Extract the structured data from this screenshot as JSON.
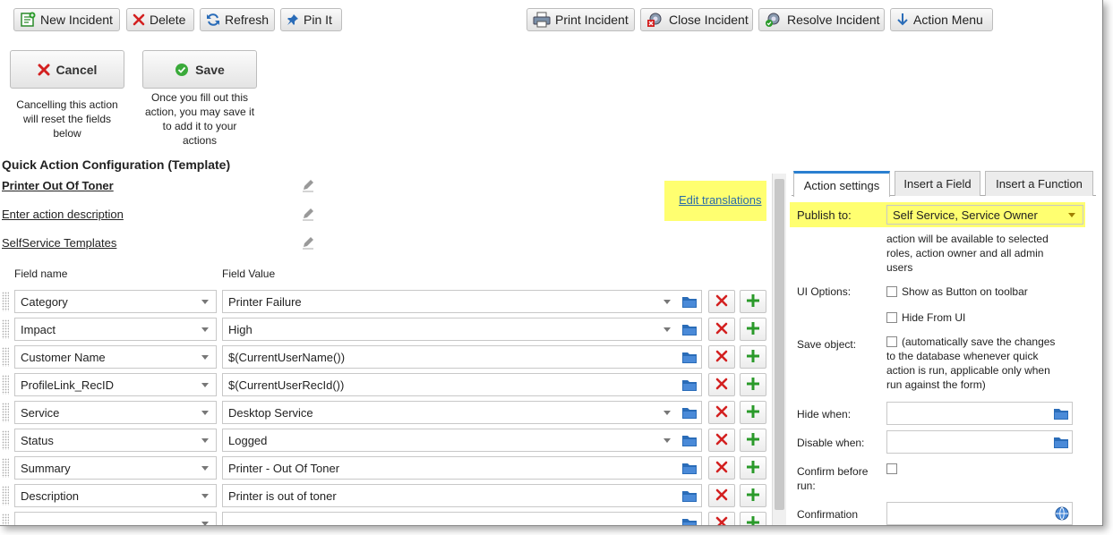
{
  "toolbar": {
    "new_incident": "New Incident",
    "delete": "Delete",
    "refresh": "Refresh",
    "pin_it": "Pin It",
    "print_incident": "Print Incident",
    "close_incident": "Close Incident",
    "resolve_incident": "Resolve Incident",
    "action_menu": "Action Menu"
  },
  "actions": {
    "cancel_label": "Cancel",
    "cancel_help": [
      "Cancelling this action",
      "will reset the fields",
      "below"
    ],
    "save_label": "Save",
    "save_help": [
      "Once you fill out this",
      "action, you may save it",
      "to add it to your",
      "actions"
    ]
  },
  "config": {
    "title": "Quick Action Configuration (Template)",
    "action_name": "Printer Out Of Toner",
    "description": "Enter action description",
    "category": "SelfService Templates",
    "edit_translations": "Edit translations"
  },
  "fields": {
    "col_name": "Field name",
    "col_value": "Field Value",
    "rows": [
      {
        "name": "Category",
        "value": "Printer Failure",
        "dropdown": true
      },
      {
        "name": "Impact",
        "value": "High",
        "dropdown": true
      },
      {
        "name": "Customer Name",
        "value": "$(CurrentUserName())",
        "dropdown": false
      },
      {
        "name": "ProfileLink_RecID",
        "value": "$(CurrentUserRecId())",
        "dropdown": false
      },
      {
        "name": "Service",
        "value": "Desktop Service",
        "dropdown": true
      },
      {
        "name": "Status",
        "value": "Logged",
        "dropdown": true
      },
      {
        "name": "Summary",
        "value": "Printer - Out Of Toner",
        "dropdown": false
      },
      {
        "name": "Description",
        "value": "Printer is out of toner",
        "dropdown": false
      },
      {
        "name": "",
        "value": "",
        "dropdown": false
      }
    ]
  },
  "panel": {
    "tabs": [
      "Action settings",
      "Insert a Field",
      "Insert a Function"
    ],
    "publish_label": "Publish to:",
    "publish_value": "Self Service, Service Owner",
    "publish_help": [
      "action will be available to selected",
      "roles, action owner and all admin",
      "users"
    ],
    "ui_options_label": "UI Options:",
    "show_as_button": "Show as Button on toolbar",
    "hide_from_ui": "Hide From UI",
    "save_object_label": "Save object:",
    "save_object_help": [
      "(automatically save the changes",
      "to the database whenever quick",
      "action is run, applicable only when",
      "run against the form)"
    ],
    "hide_when_label": "Hide when:",
    "disable_when_label": "Disable when:",
    "confirm_label": [
      "Confirm before",
      "run:"
    ],
    "confirmation_label": "Confirmation"
  },
  "colors": {
    "highlight": "#ffff70",
    "link": "#2a6ca8",
    "tab_accent": "#2a7fd0",
    "delete_red": "#d32020",
    "add_green": "#2a9a2a"
  }
}
